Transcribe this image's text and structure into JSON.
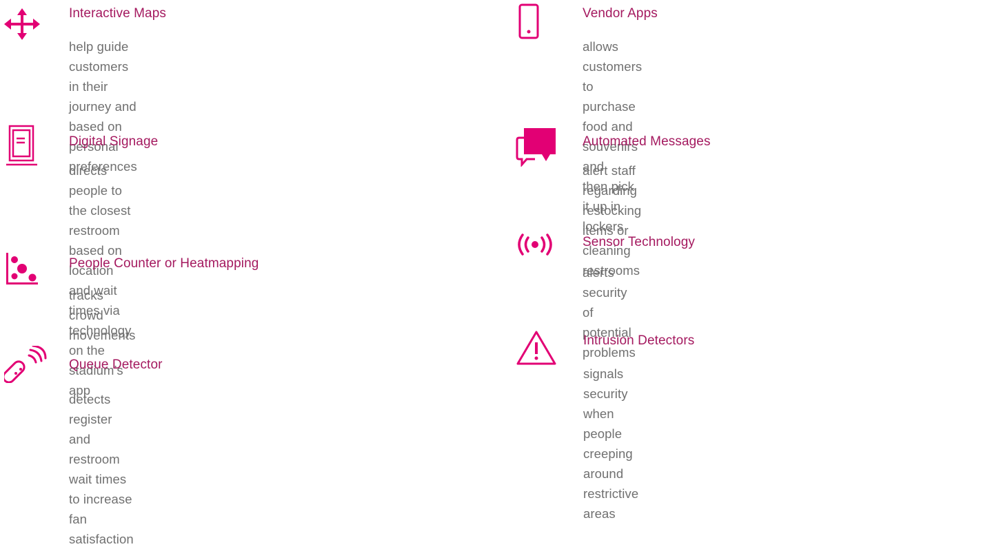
{
  "colors": {
    "accent": "#e20074",
    "title": "#a4195f",
    "text": "#707070"
  },
  "features": [
    {
      "icon": "move-arrows-icon",
      "title": "Interactive Maps",
      "desc1": "help guide customers in their journey and based on",
      "desc2": "personal preferences"
    },
    {
      "icon": "mobile-phone-icon",
      "title": "Vendor Apps",
      "desc1": "allows customers to purchase food and souvenirs and",
      "desc2": "then pick it up in lockers"
    },
    {
      "icon": "digital-sign-icon",
      "title": "Digital Signage",
      "desc1": "directs people to the closest restroom based on location",
      "desc2": "and wait times via technology on the stadium’s app"
    },
    {
      "icon": "chat-bubbles-icon",
      "title": "Automated Messages",
      "desc1": "alert staff regarding restocking items or cleaning restrooms"
    },
    {
      "icon": "scatter-plot-icon",
      "title": "People Counter or Heatmapping",
      "desc1": "tracks crowd movements"
    },
    {
      "icon": "broadcast-sensor-icon",
      "title": "Sensor Technology",
      "desc1": "alerts security of potential problems"
    },
    {
      "icon": "remote-sensor-icon",
      "title": "Queue Detector",
      "desc1": "detects register and restroom wait times to increase",
      "desc2": "fan satisfaction"
    },
    {
      "icon": "warning-triangle-icon",
      "title": "Intrusion Detectors",
      "desc1": "signals security when people creeping around",
      "desc2": "restrictive areas"
    }
  ]
}
